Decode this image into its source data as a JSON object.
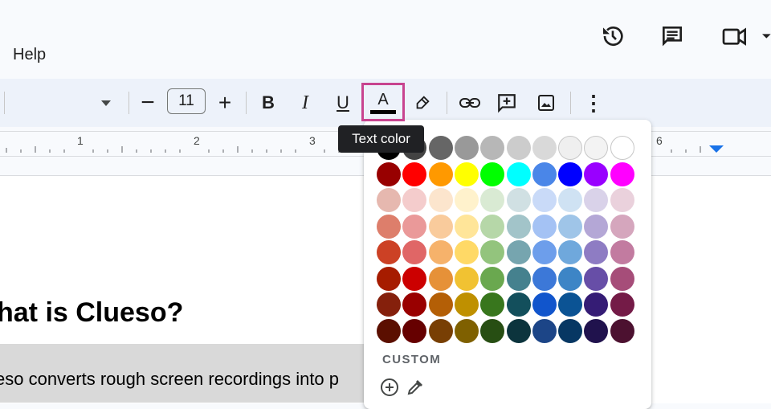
{
  "menu": {
    "help": "Help"
  },
  "toolbar": {
    "font_size": "11",
    "minus_glyph": "−",
    "plus_glyph": "+",
    "bold_glyph": "B",
    "italic_glyph": "I",
    "underline_glyph": "U",
    "text_color_glyph": "A",
    "text_color_bar": "#000000",
    "more_glyph": "⋮"
  },
  "tooltip": {
    "text": "Text color"
  },
  "ruler": {
    "labels": [
      "1",
      "2",
      "3",
      "6"
    ]
  },
  "document": {
    "heading": "hat is Clueso?",
    "paragraph": "eso converts rough screen recordings into p"
  },
  "palette": {
    "custom_label": "CUSTOM",
    "rows": [
      [
        "#000000",
        "#434343",
        "#666666",
        "#999999",
        "#b7b7b7",
        "#cccccc",
        "#d9d9d9",
        "#efefef",
        "#f3f3f3",
        "#ffffff"
      ],
      [
        "#980000",
        "#ff0000",
        "#ff9900",
        "#ffff00",
        "#00ff00",
        "#00ffff",
        "#4a86e8",
        "#0000ff",
        "#9900ff",
        "#ff00ff"
      ],
      [
        "#e6b8af",
        "#f4cccc",
        "#fce5cd",
        "#fff2cc",
        "#d9ead3",
        "#d0e0e3",
        "#c9daf8",
        "#cfe2f3",
        "#d9d2e9",
        "#ead1dc"
      ],
      [
        "#dd7e6b",
        "#ea9999",
        "#f9cb9c",
        "#ffe599",
        "#b6d7a8",
        "#a2c4c9",
        "#a4c2f4",
        "#9fc5e8",
        "#b4a7d6",
        "#d5a6bd"
      ],
      [
        "#cc4125",
        "#e06666",
        "#f6b26b",
        "#ffd966",
        "#93c47d",
        "#76a5af",
        "#6d9eeb",
        "#6fa8dc",
        "#8e7cc3",
        "#c27ba0"
      ],
      [
        "#a61c00",
        "#cc0000",
        "#e69138",
        "#f1c232",
        "#6aa84f",
        "#45818e",
        "#3c78d8",
        "#3d85c6",
        "#674ea7",
        "#a64d79"
      ],
      [
        "#85200c",
        "#990000",
        "#b45f06",
        "#bf9000",
        "#38761d",
        "#134f5c",
        "#1155cc",
        "#0b5394",
        "#351c75",
        "#741b47"
      ],
      [
        "#5b0f00",
        "#660000",
        "#783f04",
        "#7f6000",
        "#274e13",
        "#0c343d",
        "#1c4587",
        "#073763",
        "#20124d",
        "#4c1130"
      ]
    ]
  }
}
